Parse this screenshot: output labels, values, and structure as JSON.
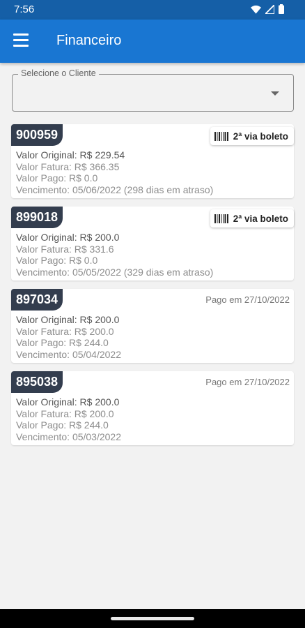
{
  "status_bar": {
    "time": "7:56"
  },
  "app_bar": {
    "title": "Financeiro"
  },
  "client_select": {
    "label": "Selecione o Cliente",
    "value": ""
  },
  "invoices": [
    {
      "id": "900959",
      "action": "2ª via boleto",
      "paid_text": "",
      "valor_original": "Valor Original: R$ 229.54",
      "valor_fatura": "Valor Fatura: R$ 366.35",
      "valor_pago": "Valor Pago: R$ 0.0",
      "vencimento": "Vencimento: 05/06/2022 (298 dias em atraso)"
    },
    {
      "id": "899018",
      "action": "2ª via boleto",
      "paid_text": "",
      "valor_original": "Valor Original: R$ 200.0",
      "valor_fatura": "Valor Fatura: R$ 331.6",
      "valor_pago": "Valor Pago: R$ 0.0",
      "vencimento": "Vencimento: 05/05/2022 (329 dias em atraso)"
    },
    {
      "id": "897034",
      "action": "",
      "paid_text": "Pago em 27/10/2022",
      "valor_original": "Valor Original: R$ 200.0",
      "valor_fatura": "Valor Fatura: R$ 200.0",
      "valor_pago": "Valor Pago: R$ 244.0",
      "vencimento": "Vencimento: 05/04/2022"
    },
    {
      "id": "895038",
      "action": "",
      "paid_text": "Pago em 27/10/2022",
      "valor_original": "Valor Original: R$ 200.0",
      "valor_fatura": "Valor Fatura: R$ 200.0",
      "valor_pago": "Valor Pago: R$ 244.0",
      "vencimento": "Vencimento: 05/03/2022"
    }
  ],
  "colors": {
    "app_bar": "#1976d2",
    "status_bar": "#155fa7",
    "id_badge": "#333d4e",
    "background": "#f2f2f2"
  },
  "icons": [
    "menu-icon",
    "dropdown-arrow-icon",
    "barcode-icon",
    "wifi-icon",
    "signal-icon",
    "battery-icon"
  ]
}
